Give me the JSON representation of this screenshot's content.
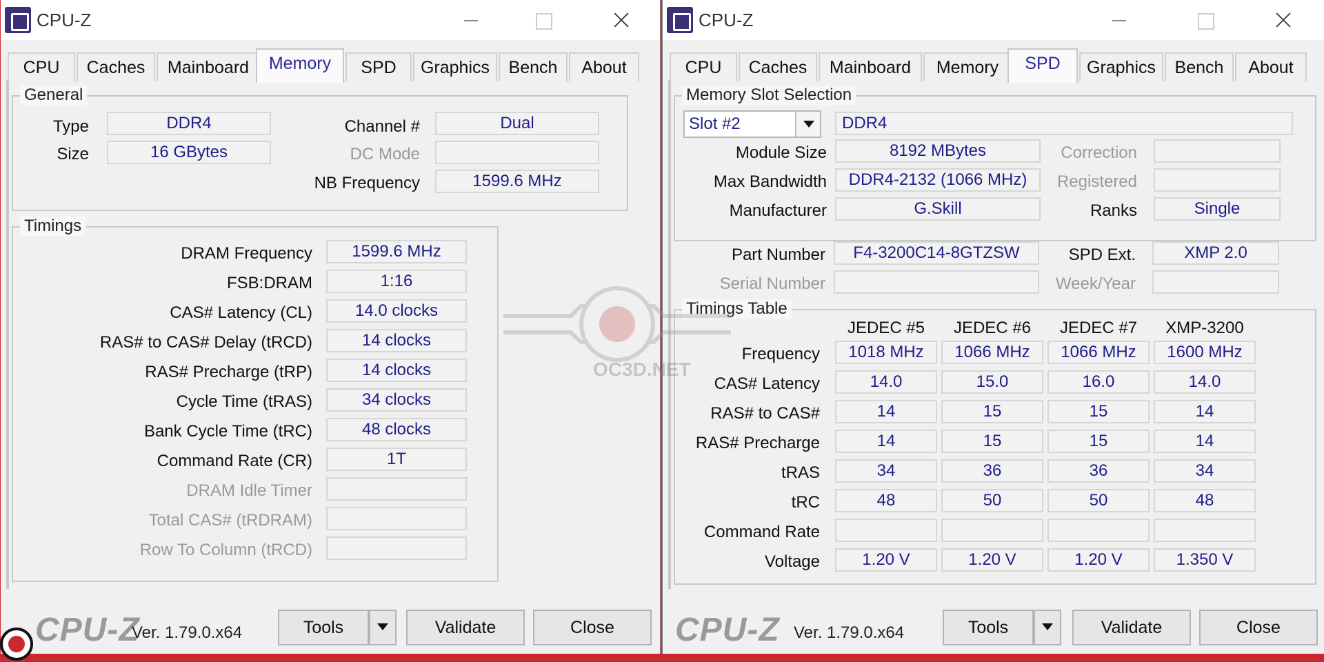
{
  "app": {
    "title": "CPU-Z",
    "brand": "CPU-Z",
    "version": "Ver. 1.79.0.x64"
  },
  "tabs": [
    "CPU",
    "Caches",
    "Mainboard",
    "Memory",
    "SPD",
    "Graphics",
    "Bench",
    "About"
  ],
  "buttons": {
    "tools": "Tools",
    "validate": "Validate",
    "close": "Close"
  },
  "memory": {
    "general": {
      "title": "General",
      "type_label": "Type",
      "type_value": "DDR4",
      "size_label": "Size",
      "size_value": "16 GBytes",
      "channel_label": "Channel #",
      "channel_value": "Dual",
      "dcmode_label": "DC Mode",
      "dcmode_value": "",
      "nbfreq_label": "NB Frequency",
      "nbfreq_value": "1599.6 MHz"
    },
    "timings": {
      "title": "Timings",
      "rows": [
        {
          "label": "DRAM Frequency",
          "value": "1599.6 MHz",
          "disabled": false
        },
        {
          "label": "FSB:DRAM",
          "value": "1:16",
          "disabled": false
        },
        {
          "label": "CAS# Latency (CL)",
          "value": "14.0 clocks",
          "disabled": false
        },
        {
          "label": "RAS# to CAS# Delay (tRCD)",
          "value": "14 clocks",
          "disabled": false
        },
        {
          "label": "RAS# Precharge (tRP)",
          "value": "14 clocks",
          "disabled": false
        },
        {
          "label": "Cycle Time (tRAS)",
          "value": "34 clocks",
          "disabled": false
        },
        {
          "label": "Bank Cycle Time (tRC)",
          "value": "48 clocks",
          "disabled": false
        },
        {
          "label": "Command Rate (CR)",
          "value": "1T",
          "disabled": false
        },
        {
          "label": "DRAM Idle Timer",
          "value": "",
          "disabled": true
        },
        {
          "label": "Total CAS# (tRDRAM)",
          "value": "",
          "disabled": true
        },
        {
          "label": "Row To Column (tRCD)",
          "value": "",
          "disabled": true
        }
      ]
    }
  },
  "spd": {
    "slot_group": {
      "title": "Memory Slot Selection",
      "slot": "Slot #2",
      "type": "DDR4",
      "module_size_label": "Module Size",
      "module_size": "8192 MBytes",
      "max_bw_label": "Max Bandwidth",
      "max_bw": "DDR4-2132 (1066 MHz)",
      "manufacturer_label": "Manufacturer",
      "manufacturer": "G.Skill",
      "part_label": "Part Number",
      "part": "F4-3200C14-8GTZSW",
      "serial_label": "Serial Number",
      "serial": "",
      "correction_label": "Correction",
      "correction": "",
      "registered_label": "Registered",
      "registered": "",
      "ranks_label": "Ranks",
      "ranks": "Single",
      "spdext_label": "SPD Ext.",
      "spdext": "XMP 2.0",
      "weekyear_label": "Week/Year",
      "weekyear": ""
    },
    "timings_table": {
      "title": "Timings Table",
      "columns": [
        "JEDEC #5",
        "JEDEC #6",
        "JEDEC #7",
        "XMP-3200"
      ],
      "rows": [
        {
          "label": "Frequency",
          "values": [
            "1018 MHz",
            "1066 MHz",
            "1066 MHz",
            "1600 MHz"
          ]
        },
        {
          "label": "CAS# Latency",
          "values": [
            "14.0",
            "15.0",
            "16.0",
            "14.0"
          ]
        },
        {
          "label": "RAS# to CAS#",
          "values": [
            "14",
            "15",
            "15",
            "14"
          ]
        },
        {
          "label": "RAS# Precharge",
          "values": [
            "14",
            "15",
            "15",
            "14"
          ]
        },
        {
          "label": "tRAS",
          "values": [
            "34",
            "36",
            "36",
            "34"
          ]
        },
        {
          "label": "tRC",
          "values": [
            "48",
            "50",
            "50",
            "48"
          ]
        },
        {
          "label": "Command Rate",
          "values": [
            "",
            "",
            "",
            ""
          ]
        },
        {
          "label": "Voltage",
          "values": [
            "1.20 V",
            "1.20 V",
            "1.20 V",
            "1.350 V"
          ]
        }
      ]
    }
  },
  "watermark": {
    "text": "OC3D.NET"
  }
}
